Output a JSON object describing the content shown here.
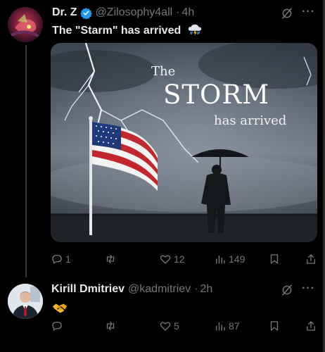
{
  "tweets": [
    {
      "author": "Dr. Z",
      "handle": "@Zilosophy4all",
      "time": "4h",
      "text": "The \"Starm\" has arrived",
      "emoji": "cloud-lightning-rain-emoji",
      "image": {
        "line1": "The",
        "line2": "STORM",
        "line3": "has arrived"
      },
      "stats": {
        "replies": "1",
        "reposts": "",
        "likes": "12",
        "views": "149"
      }
    },
    {
      "author": "Kirill Dmitriev",
      "handle": "@kadmitriev",
      "time": "2h",
      "text": "",
      "emoji": "handshake-emoji",
      "stats": {
        "replies": "",
        "reposts": "",
        "likes": "5",
        "views": "87"
      }
    }
  ],
  "separator": "·",
  "colors": {
    "background": "#000000",
    "text": "#e7e9ea",
    "muted": "#71767b",
    "verified": "#1d9bf0"
  }
}
